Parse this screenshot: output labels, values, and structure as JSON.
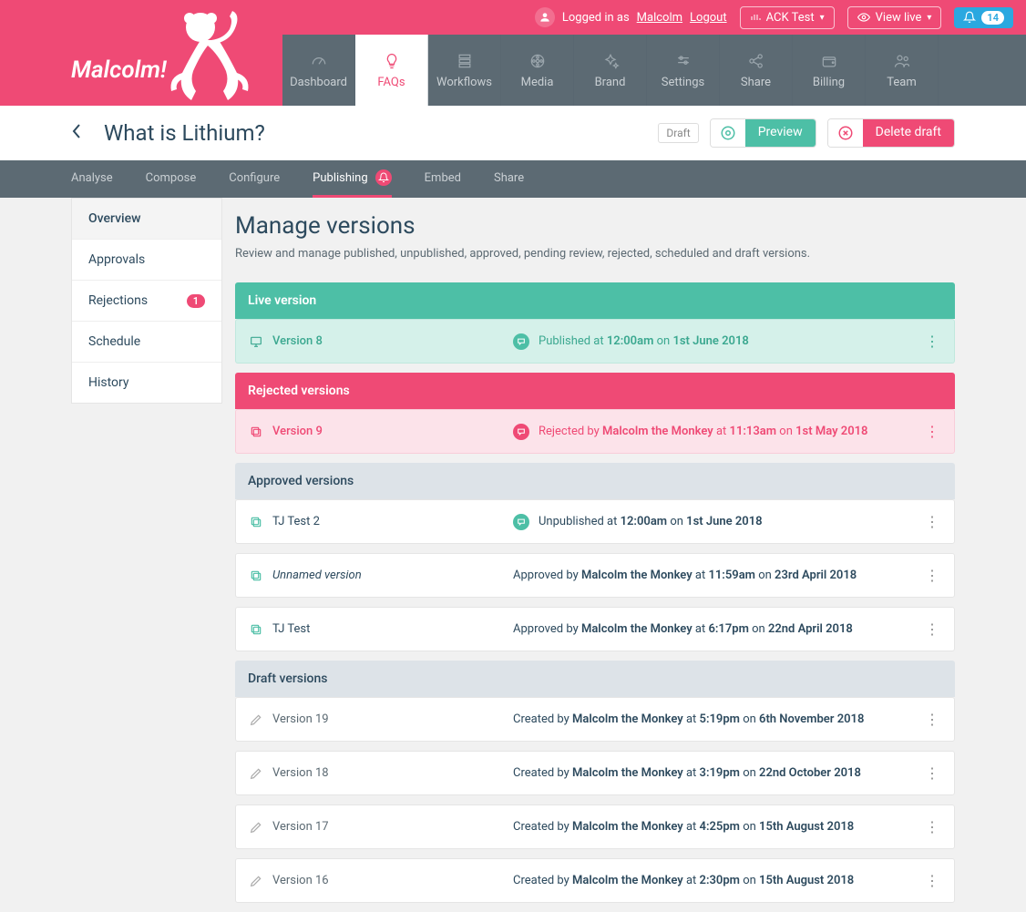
{
  "topbar": {
    "logged_prefix": "Logged in as ",
    "username": "Malcolm",
    "logout": "Logout",
    "ack_test": "ACK Test",
    "view_live": "View live",
    "notif_count": "14"
  },
  "brand": "Malcolm!",
  "mainnav": [
    {
      "label": "Dashboard",
      "icon": "gauge"
    },
    {
      "label": "FAQs",
      "icon": "bulb",
      "active": true
    },
    {
      "label": "Workflows",
      "icon": "stack"
    },
    {
      "label": "Media",
      "icon": "film"
    },
    {
      "label": "Brand",
      "icon": "sparkle"
    },
    {
      "label": "Settings",
      "icon": "sliders"
    },
    {
      "label": "Share",
      "icon": "share"
    },
    {
      "label": "Billing",
      "icon": "wallet"
    },
    {
      "label": "Team",
      "icon": "team"
    }
  ],
  "title": "What is Lithium?",
  "titlebar": {
    "draft": "Draft",
    "preview": "Preview",
    "delete": "Delete draft"
  },
  "subnav": [
    {
      "label": "Analyse"
    },
    {
      "label": "Compose"
    },
    {
      "label": "Configure"
    },
    {
      "label": "Publishing",
      "active": true,
      "badge": true
    },
    {
      "label": "Embed"
    },
    {
      "label": "Share"
    }
  ],
  "sidebar": [
    {
      "label": "Overview",
      "active": true
    },
    {
      "label": "Approvals"
    },
    {
      "label": "Rejections",
      "badge": "1"
    },
    {
      "label": "Schedule"
    },
    {
      "label": "History"
    }
  ],
  "page": {
    "heading": "Manage versions",
    "sub": "Review and manage published, unpublished, approved, pending review, rejected, scheduled and draft versions."
  },
  "sections": {
    "live": {
      "title": "Live version",
      "rows": [
        {
          "name": "Version 8",
          "status_pre": "Published at ",
          "time": "12:00am",
          "on": " on ",
          "date": "1st June 2018",
          "comment": true
        }
      ]
    },
    "rejected": {
      "title": "Rejected versions",
      "rows": [
        {
          "name": "Version 9",
          "status_pre": "Rejected by ",
          "who": "Malcolm the Monkey",
          "at": " at ",
          "time": "11:13am",
          "on": " on ",
          "date": "1st May 2018",
          "comment": true
        }
      ]
    },
    "approved": {
      "title": "Approved versions",
      "rows": [
        {
          "name": "TJ Test 2",
          "status_pre": "Unpublished at ",
          "time": "12:00am",
          "on": " on ",
          "date": "1st June 2018",
          "comment": true
        },
        {
          "name": "Unnamed version",
          "italic": true,
          "status_pre": "Approved by ",
          "who": "Malcolm the Monkey",
          "at": " at ",
          "time": "11:59am",
          "on": " on ",
          "date": "23rd April 2018"
        },
        {
          "name": "TJ Test",
          "status_pre": "Approved by ",
          "who": "Malcolm the Monkey",
          "at": " at ",
          "time": "6:17pm",
          "on": " on ",
          "date": "22nd April 2018"
        }
      ]
    },
    "draft": {
      "title": "Draft versions",
      "rows": [
        {
          "name": "Version 19",
          "status_pre": "Created by ",
          "who": "Malcolm the Monkey",
          "at": " at ",
          "time": "5:19pm",
          "on": " on ",
          "date": "6th November 2018"
        },
        {
          "name": "Version 18",
          "status_pre": "Created by ",
          "who": "Malcolm the Monkey",
          "at": " at ",
          "time": "3:19pm",
          "on": " on ",
          "date": "22nd October 2018"
        },
        {
          "name": "Version 17",
          "status_pre": "Created by ",
          "who": "Malcolm the Monkey",
          "at": " at ",
          "time": "4:25pm",
          "on": " on ",
          "date": "15th August 2018"
        },
        {
          "name": "Version 16",
          "status_pre": "Created by ",
          "who": "Malcolm the Monkey",
          "at": " at ",
          "time": "2:30pm",
          "on": " on ",
          "date": "15th August 2018"
        }
      ]
    }
  }
}
